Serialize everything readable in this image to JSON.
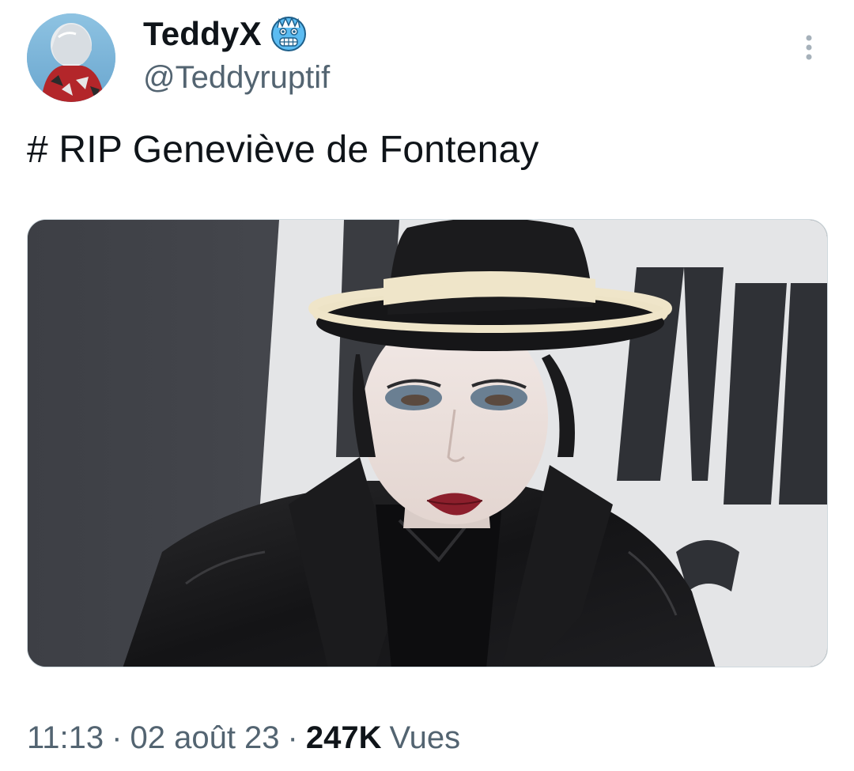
{
  "tweet": {
    "display_name": "TeddyX",
    "name_emoji": "cold-face-emoji",
    "handle": "@Teddyruptif",
    "text": "# RIP Geneviève de Fontenay",
    "media": {
      "description_icon": "photo",
      "backdrop_letters": "AVE"
    },
    "footer": {
      "time": "11:13",
      "separator": "·",
      "date": "02 août 23",
      "views_count": "247K",
      "views_label": "Vues"
    }
  },
  "colors": {
    "text_primary": "#0f1419",
    "text_secondary": "#536471",
    "emoji_blue": "#4fb3ef",
    "more_icon": "#a6b1ba"
  },
  "icons": {
    "more": "more-vertical-icon",
    "emoji": "cold-face-icon"
  }
}
